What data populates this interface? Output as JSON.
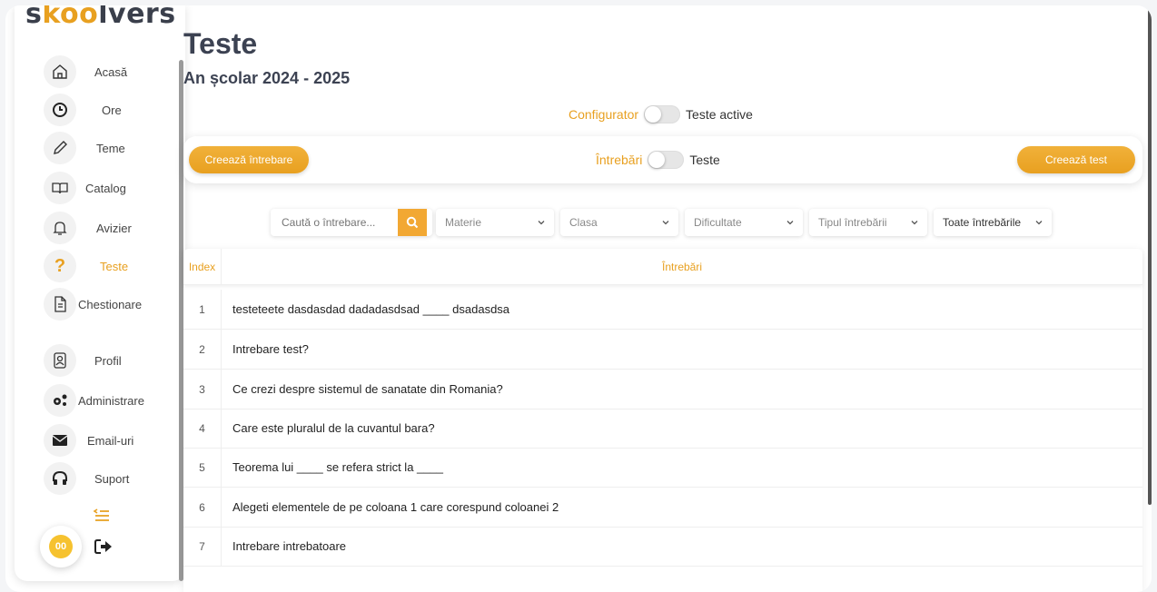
{
  "sidebar": {
    "logo": {
      "prefix": "s",
      "middle": "koo",
      "suffix": "lvers"
    },
    "items": [
      {
        "label": "Acasă",
        "icon": "home-icon"
      },
      {
        "label": "Ore",
        "icon": "clock-icon"
      },
      {
        "label": "Teme",
        "icon": "pencil-icon"
      },
      {
        "label": "Catalog",
        "icon": "book-icon"
      },
      {
        "label": "Avizier",
        "icon": "bell-icon"
      },
      {
        "label": "Teste",
        "icon": "question-icon",
        "active": true
      },
      {
        "label": "Chestionare",
        "icon": "document-icon"
      },
      {
        "label": "Profil",
        "icon": "profile-icon"
      },
      {
        "label": "Administrare",
        "icon": "gears-icon"
      },
      {
        "label": "Email-uri",
        "icon": "mail-icon"
      },
      {
        "label": "Suport",
        "icon": "headphones-icon"
      }
    ],
    "avatar_text": "00"
  },
  "header": {
    "title": "Teste",
    "subtitle": "An școlar 2024 - 2025"
  },
  "mode_toggle": {
    "left": "Configurator",
    "right": "Teste active"
  },
  "action_bar": {
    "create_question": "Creează întrebare",
    "toggle_left": "Întrebări",
    "toggle_right": "Teste",
    "create_test": "Creează test"
  },
  "filters": {
    "search_placeholder": "Caută o întrebare...",
    "subject": "Materie",
    "class": "Clasa",
    "difficulty": "Dificultate",
    "question_type": "Tipul întrebării",
    "all_questions": "Toate întrebările"
  },
  "table": {
    "col_index": "Index",
    "col_questions": "Întrebări",
    "rows": [
      {
        "index": "1",
        "question": "testeteete dasdasdad dadadasdsad ____ dsadasdsa"
      },
      {
        "index": "2",
        "question": "Intrebare test?"
      },
      {
        "index": "3",
        "question": "Ce crezi despre sistemul de sanatate din Romania?"
      },
      {
        "index": "4",
        "question": "Care este pluralul de la cuvantul bara?"
      },
      {
        "index": "5",
        "question": "Teorema lui ____ se refera strict la ____"
      },
      {
        "index": "6",
        "question": "Alegeti elementele de pe coloana 1 care corespund coloanei 2"
      },
      {
        "index": "7",
        "question": "Intrebare intrebatoare"
      }
    ]
  },
  "colors": {
    "accent": "#e8a020",
    "title": "#3c4252"
  }
}
